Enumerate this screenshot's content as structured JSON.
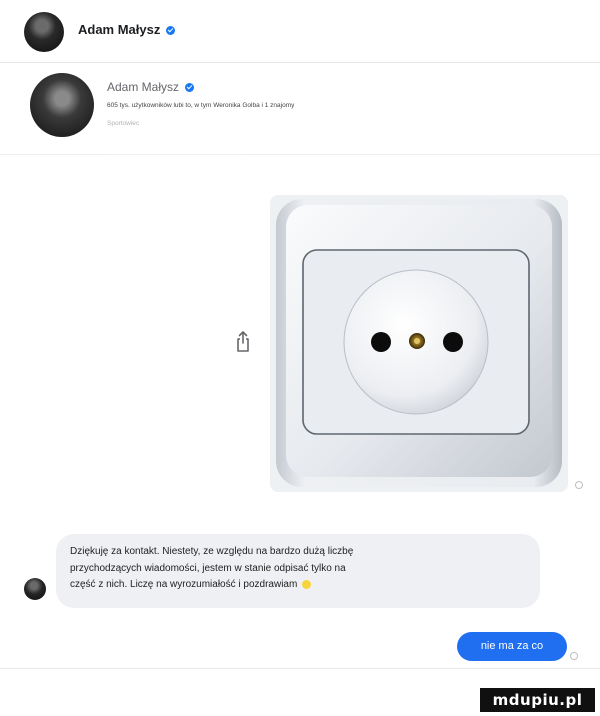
{
  "header": {
    "name": "Adam Małysz",
    "verified_icon": "verified-badge-icon",
    "avatar_icon": "profile-photo"
  },
  "profile": {
    "name": "Adam Małysz",
    "friends_text": "605 tys. użytkowników lubi to, w tym Weronika Golba i 1 znajomy",
    "category": "Sportowiec"
  },
  "conversation": {
    "shared_image_subject": "white wall power socket",
    "share_icon": "share-icon",
    "reply_lines": [
      "Dziękuję za kontakt. Niestety, ze względu na bardzo dużą liczbę",
      "przychodzących wiadomości, jestem w stanie odpisać tylko na",
      "część z nich. Liczę na wyrozumiałość i pozdrawiam"
    ],
    "reply_emoji": "smiley-emoji-icon",
    "sent_message": "nie ma za co"
  },
  "watermark": {
    "text": "mdupiu.pl"
  },
  "colors": {
    "accent": "#1877f2",
    "sent_bubble": "#1f6ff0",
    "received_bubble": "#eef0f3",
    "muted_text": "#65676b"
  }
}
